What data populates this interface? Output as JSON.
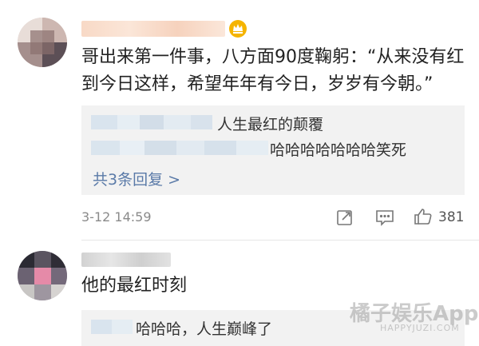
{
  "comments": [
    {
      "body_line1": "哥出来第一件事，八方面90度鞠躬：“从来没有红",
      "body_line2": "到今日这样，希望年年有今日，岁岁有今朝。”",
      "replies": [
        {
          "text": "人生最红的颠覆"
        },
        {
          "text": "哈哈哈哈哈哈哈笑死"
        }
      ],
      "more_replies": "共3条回复 >",
      "timestamp": "3-12 14:59",
      "like_count": "381"
    },
    {
      "body": "他的最红时刻",
      "replies": [
        {
          "text": "哈哈哈，人生巅峰了"
        }
      ]
    }
  ],
  "watermark": {
    "brand": "橘子娱乐App",
    "url": "HAPPYJUZI.COM"
  },
  "colors": {
    "link": "#5a7aa8",
    "meta": "#8a8a8a",
    "reply_bg": "#f2f2f2"
  }
}
